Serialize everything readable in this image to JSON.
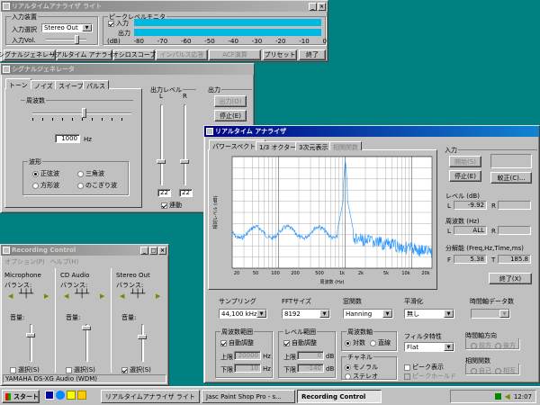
{
  "win_rta_lite": {
    "title": "リアルタイムアナライザ ライト",
    "input_settings": {
      "label": "入力装置",
      "device_label": "入力選択",
      "device_value": "Stereo Out",
      "vol_label": "入力Vol."
    },
    "peak": {
      "label": "ピークレベルモニタ",
      "in_label": "入力",
      "out_label": "出力",
      "scale": [
        "(dB)",
        "-80",
        "-70",
        "-60",
        "-50",
        "-40",
        "-30",
        "-20",
        "-10",
        "0"
      ]
    },
    "buttons": [
      "シグナルジェネレータ",
      "リアルタイム アナライザ",
      "オシロスコープ",
      "インパルス応答",
      "ACF演算",
      "プリセット",
      "終了"
    ]
  },
  "win_siggen": {
    "title": "シグナルジェネレータ",
    "tabs": [
      "トーン",
      "ノイズ",
      "スイープ",
      "パルス"
    ],
    "freq_label": "周波数",
    "freq_value": "1000",
    "freq_unit": "Hz",
    "wave_label": "波形",
    "waves": [
      "正弦波",
      "三角波",
      "方形波",
      "のこぎり波"
    ],
    "out_level_label": "出力レベル",
    "l": "L",
    "r": "R",
    "level_l": "22",
    "level_r": "22",
    "link_label": "連動",
    "out_label": "出力",
    "out_btn": "出力(O)",
    "stop_btn": "停止(E)"
  },
  "win_rec": {
    "title": "Recording Control",
    "menu": [
      "オプション(P)",
      "ヘルプ(H)"
    ],
    "channels": [
      {
        "name": "Microphone",
        "select": "選択(S)",
        "checked": false
      },
      {
        "name": "CD Audio",
        "select": "選択(S)",
        "checked": false
      },
      {
        "name": "Stereo Out",
        "select": "選択(S)",
        "checked": true
      }
    ],
    "balance_label": "バランス:",
    "volume_label": "音量:",
    "status": "YAMAHA DS-XG Audio (WDM)"
  },
  "win_rta": {
    "title": "リアルタイム アナライザ",
    "tabs": [
      "パワースペクトル",
      "1/3 オクターブ",
      "3次元表示",
      "相関関数"
    ],
    "chart": {
      "ylabel": "相対レベル (dB)",
      "xlabel": "周波数 (Hz)",
      "xticks": [
        "20",
        "50",
        "100",
        "200",
        "500",
        "1k",
        "2k",
        "5k",
        "10k",
        "20k"
      ]
    },
    "input": {
      "label": "入力",
      "start": "開始(S)",
      "stop": "停止(E)",
      "calib": "較正(C)..."
    },
    "level": {
      "label": "レベル (dB)",
      "l": "L",
      "l_value": "-9.92",
      "r": "R",
      "r_value": ""
    },
    "freq": {
      "label": "周波数 (Hz)",
      "l": "L",
      "l_value": "ALL",
      "r": "R",
      "r_value": ""
    },
    "res": {
      "label": "分解能 (Freq,Hz,Time,ms)",
      "f": "F",
      "f_value": "5.38",
      "t": "T",
      "t_value": "185.8"
    },
    "close": "終了(X)",
    "sampling": {
      "label": "サンプリング",
      "value": "44,100 kHz"
    },
    "fft": {
      "label": "FFTサイズ",
      "value": "8192"
    },
    "window": {
      "label": "窓関数",
      "value": "Hanning"
    },
    "smooth": {
      "label": "平滑化",
      "value": "無し"
    },
    "timeaxis": {
      "label": "時間軸データ数",
      "value": ""
    },
    "freqrange": {
      "label": "周波数範囲",
      "auto": "自動調整",
      "upper": "上限",
      "upper_value": "20000",
      "lower": "下限",
      "lower_value": "10",
      "unit": "Hz"
    },
    "levelrange": {
      "label": "レベル範囲",
      "auto": "自動調整",
      "upper": "上限",
      "upper_value": "0",
      "lower": "下限",
      "lower_value": "-140",
      "unit": "dB"
    },
    "freqaxis": {
      "label": "周波数軸",
      "log": "対数",
      "lin": "直線"
    },
    "filter": {
      "label": "フィルタ特性",
      "value": "Flat"
    },
    "timedir": {
      "label": "時間軸方向",
      "fwd": "前方",
      "back": "後方"
    },
    "channel": {
      "label": "チャネル",
      "mono": "モノラル",
      "stereo": "ステレオ"
    },
    "peak": {
      "label": "ピーク表示",
      "hold": "ピークホールド"
    },
    "corr": {
      "label": "相関関数",
      "a": "自己",
      "b": "相互"
    }
  },
  "taskbar": {
    "start": "スタート",
    "tasks": [
      "リアルタイムアナライザ ライト",
      "Jasc Paint Shop Pro - s...",
      "Recording Control"
    ],
    "clock": "12:07"
  },
  "colors": {
    "accent": "#000080",
    "spectrum": "#1e90ff",
    "meter": "#00b8e0",
    "desktop": "#008080"
  }
}
